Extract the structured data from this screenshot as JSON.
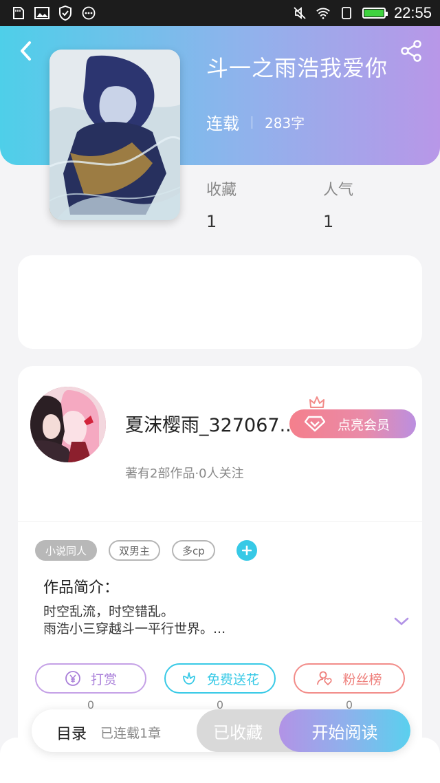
{
  "status_bar": {
    "time": "22:55",
    "left_icons": [
      "sim-card-icon",
      "image-icon",
      "shield-icon",
      "more-dots-icon"
    ],
    "right_icons": [
      "mute-icon",
      "wifi-icon",
      "portrait-lock-icon",
      "battery-icon"
    ]
  },
  "book": {
    "title": "斗一之雨浩我爱你",
    "status": "连载",
    "word_count": "283字"
  },
  "stats": [
    {
      "label": "收藏",
      "value": "1"
    },
    {
      "label": "人气",
      "value": "1"
    }
  ],
  "author": {
    "name": "夏沫樱雨_327067...",
    "vip_label": "点亮会员",
    "summary": "著有2部作品·0人关注"
  },
  "tags": [
    "小说同人",
    "双男主",
    "多cp"
  ],
  "intro": {
    "title": "作品简介：",
    "line1": "时空乱流，时空错乱。",
    "line2": "雨浩小三穿越斗一平行世界。..."
  },
  "actions": [
    {
      "label": "打赏",
      "count": "0",
      "color": "#a97fd9"
    },
    {
      "label": "免费送花",
      "count": "0",
      "color": "#37c9e6"
    },
    {
      "label": "粉丝榜",
      "count": "0",
      "color": "#ee7e7a"
    }
  ],
  "bottom": {
    "toc_label": "目录",
    "chapters": "已连载1章",
    "collect_label": "已收藏",
    "read_label": "开始阅读"
  },
  "colors": {
    "header_gradient_start": "#4ecfe9",
    "header_gradient_end": "#b897e8",
    "accent_cyan": "#37c9e6",
    "accent_purple": "#b293e6"
  }
}
